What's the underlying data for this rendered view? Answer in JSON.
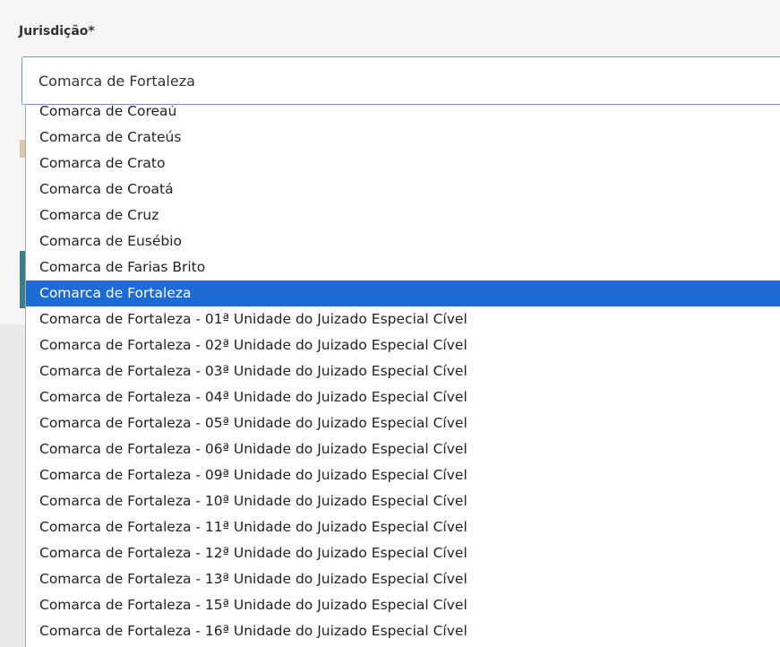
{
  "field": {
    "label": "Jurisdição*",
    "selected_value": "Comarca de Fortaleza"
  },
  "dropdown": {
    "selected_index": 7,
    "selected_color": "#1e6bd6",
    "options": [
      "Comarca de Coreaú",
      "Comarca de Crateús",
      "Comarca de Crato",
      "Comarca de Croatá",
      "Comarca de Cruz",
      "Comarca de Eusébio",
      "Comarca de Farias Brito",
      "Comarca de Fortaleza",
      "Comarca de Fortaleza - 01ª Unidade do Juizado Especial Cível",
      "Comarca de Fortaleza - 02ª Unidade do Juizado Especial Cível",
      "Comarca de Fortaleza - 03ª Unidade do Juizado Especial Cível",
      "Comarca de Fortaleza - 04ª Unidade do Juizado Especial Cível",
      "Comarca de Fortaleza - 05ª Unidade do Juizado Especial Cível",
      "Comarca de Fortaleza - 06ª Unidade do Juizado Especial Cível",
      "Comarca de Fortaleza - 09ª Unidade do Juizado Especial Cível",
      "Comarca de Fortaleza - 10ª Unidade do Juizado Especial Cível",
      "Comarca de Fortaleza - 11ª Unidade do Juizado Especial Cível",
      "Comarca de Fortaleza - 12ª Unidade do Juizado Especial Cível",
      "Comarca de Fortaleza - 13ª Unidade do Juizado Especial Cível",
      "Comarca de Fortaleza - 15ª Unidade do Juizado Especial Cível",
      "Comarca de Fortaleza - 16ª Unidade do Juizado Especial Cível"
    ]
  }
}
